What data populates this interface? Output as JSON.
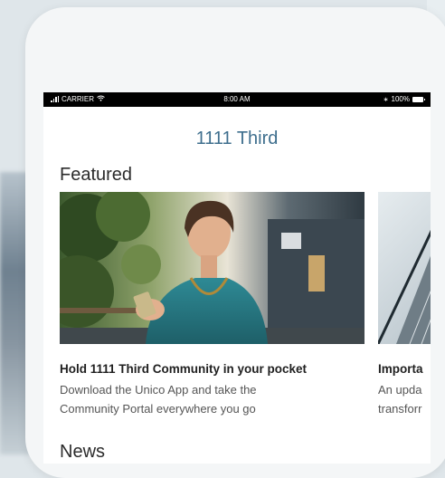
{
  "status_bar": {
    "carrier": "CARRIER",
    "time": "8:00 AM",
    "battery": "100%"
  },
  "header": {
    "title": "1111 Third"
  },
  "featured": {
    "heading": "Featured",
    "cards": [
      {
        "title": "Hold 1111 Third Community in your pocket",
        "description": "Download the Unico App and take the\nCommunity Portal everywhere you go"
      },
      {
        "title": "Importa",
        "description": "An upda\ntransforr"
      }
    ]
  },
  "news": {
    "heading": "News"
  },
  "colors": {
    "accent": "#3f6f8e",
    "status_bar": "#000000"
  }
}
